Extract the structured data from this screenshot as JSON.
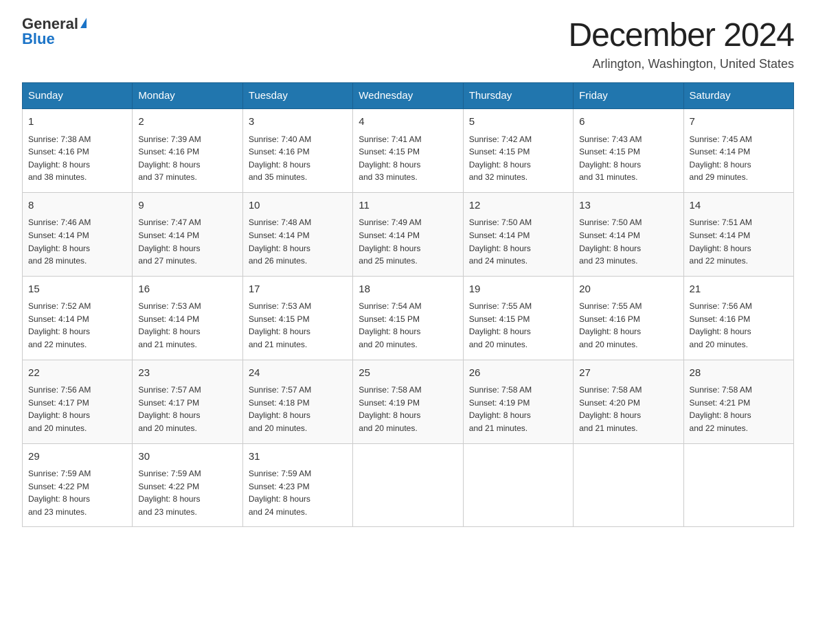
{
  "header": {
    "logo_general": "General",
    "logo_blue": "Blue",
    "title": "December 2024",
    "location": "Arlington, Washington, United States"
  },
  "days_of_week": [
    "Sunday",
    "Monday",
    "Tuesday",
    "Wednesday",
    "Thursday",
    "Friday",
    "Saturday"
  ],
  "weeks": [
    [
      {
        "day": "1",
        "sunrise": "7:38 AM",
        "sunset": "4:16 PM",
        "daylight": "8 hours and 38 minutes."
      },
      {
        "day": "2",
        "sunrise": "7:39 AM",
        "sunset": "4:16 PM",
        "daylight": "8 hours and 37 minutes."
      },
      {
        "day": "3",
        "sunrise": "7:40 AM",
        "sunset": "4:16 PM",
        "daylight": "8 hours and 35 minutes."
      },
      {
        "day": "4",
        "sunrise": "7:41 AM",
        "sunset": "4:15 PM",
        "daylight": "8 hours and 33 minutes."
      },
      {
        "day": "5",
        "sunrise": "7:42 AM",
        "sunset": "4:15 PM",
        "daylight": "8 hours and 32 minutes."
      },
      {
        "day": "6",
        "sunrise": "7:43 AM",
        "sunset": "4:15 PM",
        "daylight": "8 hours and 31 minutes."
      },
      {
        "day": "7",
        "sunrise": "7:45 AM",
        "sunset": "4:14 PM",
        "daylight": "8 hours and 29 minutes."
      }
    ],
    [
      {
        "day": "8",
        "sunrise": "7:46 AM",
        "sunset": "4:14 PM",
        "daylight": "8 hours and 28 minutes."
      },
      {
        "day": "9",
        "sunrise": "7:47 AM",
        "sunset": "4:14 PM",
        "daylight": "8 hours and 27 minutes."
      },
      {
        "day": "10",
        "sunrise": "7:48 AM",
        "sunset": "4:14 PM",
        "daylight": "8 hours and 26 minutes."
      },
      {
        "day": "11",
        "sunrise": "7:49 AM",
        "sunset": "4:14 PM",
        "daylight": "8 hours and 25 minutes."
      },
      {
        "day": "12",
        "sunrise": "7:50 AM",
        "sunset": "4:14 PM",
        "daylight": "8 hours and 24 minutes."
      },
      {
        "day": "13",
        "sunrise": "7:50 AM",
        "sunset": "4:14 PM",
        "daylight": "8 hours and 23 minutes."
      },
      {
        "day": "14",
        "sunrise": "7:51 AM",
        "sunset": "4:14 PM",
        "daylight": "8 hours and 22 minutes."
      }
    ],
    [
      {
        "day": "15",
        "sunrise": "7:52 AM",
        "sunset": "4:14 PM",
        "daylight": "8 hours and 22 minutes."
      },
      {
        "day": "16",
        "sunrise": "7:53 AM",
        "sunset": "4:14 PM",
        "daylight": "8 hours and 21 minutes."
      },
      {
        "day": "17",
        "sunrise": "7:53 AM",
        "sunset": "4:15 PM",
        "daylight": "8 hours and 21 minutes."
      },
      {
        "day": "18",
        "sunrise": "7:54 AM",
        "sunset": "4:15 PM",
        "daylight": "8 hours and 20 minutes."
      },
      {
        "day": "19",
        "sunrise": "7:55 AM",
        "sunset": "4:15 PM",
        "daylight": "8 hours and 20 minutes."
      },
      {
        "day": "20",
        "sunrise": "7:55 AM",
        "sunset": "4:16 PM",
        "daylight": "8 hours and 20 minutes."
      },
      {
        "day": "21",
        "sunrise": "7:56 AM",
        "sunset": "4:16 PM",
        "daylight": "8 hours and 20 minutes."
      }
    ],
    [
      {
        "day": "22",
        "sunrise": "7:56 AM",
        "sunset": "4:17 PM",
        "daylight": "8 hours and 20 minutes."
      },
      {
        "day": "23",
        "sunrise": "7:57 AM",
        "sunset": "4:17 PM",
        "daylight": "8 hours and 20 minutes."
      },
      {
        "day": "24",
        "sunrise": "7:57 AM",
        "sunset": "4:18 PM",
        "daylight": "8 hours and 20 minutes."
      },
      {
        "day": "25",
        "sunrise": "7:58 AM",
        "sunset": "4:19 PM",
        "daylight": "8 hours and 20 minutes."
      },
      {
        "day": "26",
        "sunrise": "7:58 AM",
        "sunset": "4:19 PM",
        "daylight": "8 hours and 21 minutes."
      },
      {
        "day": "27",
        "sunrise": "7:58 AM",
        "sunset": "4:20 PM",
        "daylight": "8 hours and 21 minutes."
      },
      {
        "day": "28",
        "sunrise": "7:58 AM",
        "sunset": "4:21 PM",
        "daylight": "8 hours and 22 minutes."
      }
    ],
    [
      {
        "day": "29",
        "sunrise": "7:59 AM",
        "sunset": "4:22 PM",
        "daylight": "8 hours and 23 minutes."
      },
      {
        "day": "30",
        "sunrise": "7:59 AM",
        "sunset": "4:22 PM",
        "daylight": "8 hours and 23 minutes."
      },
      {
        "day": "31",
        "sunrise": "7:59 AM",
        "sunset": "4:23 PM",
        "daylight": "8 hours and 24 minutes."
      },
      null,
      null,
      null,
      null
    ]
  ],
  "labels": {
    "sunrise": "Sunrise:",
    "sunset": "Sunset:",
    "daylight": "Daylight:"
  }
}
